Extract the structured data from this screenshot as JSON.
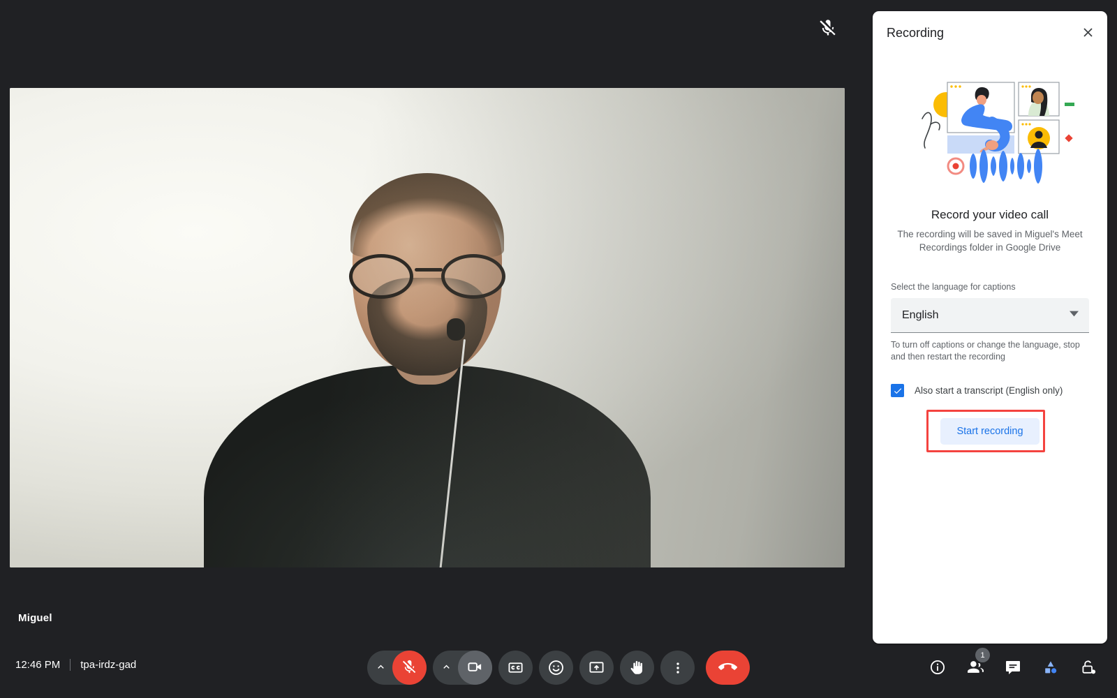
{
  "meeting": {
    "time": "12:46 PM",
    "code": "tpa-irdz-gad",
    "participant_name": "Miguel",
    "self_mic_status_icon": "mic-off-icon"
  },
  "controls": {
    "mic": {
      "label": "Turn off microphone",
      "state": "muted",
      "icon": "mic-off-icon",
      "color": "#ea4335"
    },
    "mic_caret": {
      "label": "Audio settings",
      "icon": "chevron-up-icon"
    },
    "camera": {
      "label": "Turn off camera",
      "icon": "video-camera-icon"
    },
    "camera_caret": {
      "label": "Video settings",
      "icon": "chevron-up-icon"
    },
    "captions": {
      "label": "Turn on captions",
      "icon": "closed-caption-icon"
    },
    "reactions": {
      "label": "Send a reaction",
      "icon": "emoji-smiley-icon"
    },
    "present": {
      "label": "Present now",
      "icon": "present-screen-icon"
    },
    "raise_hand": {
      "label": "Raise hand",
      "icon": "raised-hand-icon"
    },
    "more": {
      "label": "More options",
      "icon": "more-vertical-icon"
    },
    "leave": {
      "label": "Leave call",
      "icon": "end-call-icon",
      "color": "#ea4335"
    }
  },
  "right_controls": {
    "info": {
      "label": "Meeting details",
      "icon": "info-circle-icon"
    },
    "people": {
      "label": "People",
      "icon": "people-icon",
      "badge": "1"
    },
    "chat": {
      "label": "Chat with everyone",
      "icon": "chat-bubble-icon"
    },
    "activities": {
      "label": "Activities",
      "icon": "activities-shapes-icon"
    },
    "host_controls": {
      "label": "Host controls",
      "icon": "lock-shield-icon"
    }
  },
  "panel": {
    "title": "Recording",
    "close_icon": "close-icon",
    "illustration": "record-video-call-illustration",
    "heading": "Record your video call",
    "subtext": "The recording will be saved in Miguel's Meet Recordings folder in Google Drive",
    "language_label": "Select the language for captions",
    "language_value": "English",
    "language_caret_icon": "chevron-down-icon",
    "hint": "To turn off captions or change the language, stop and then restart the recording",
    "transcript_checkbox": {
      "label": "Also start a transcript (English only)",
      "checked": true
    },
    "start_button": "Start recording",
    "accent_color": "#1a73e8",
    "highlight_color": "#f4433f"
  }
}
